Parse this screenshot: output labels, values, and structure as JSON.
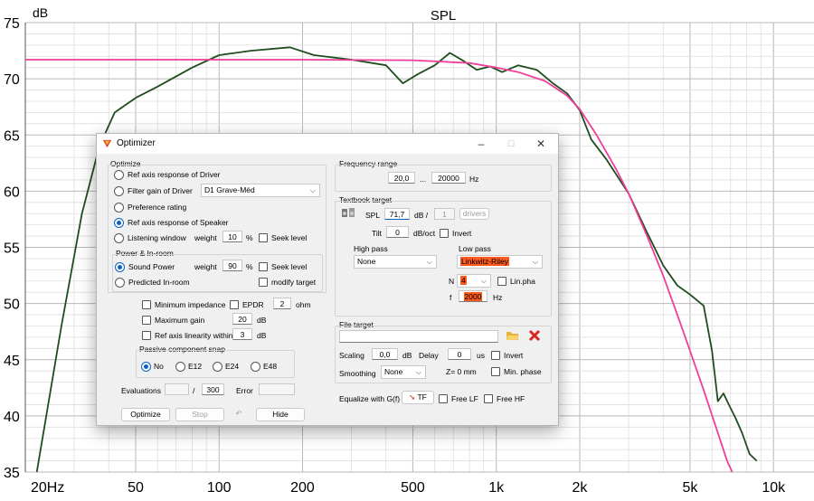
{
  "chart_data": {
    "type": "line",
    "title": "SPL",
    "ylabel": "dB",
    "xscale": "log",
    "xlim": [
      20,
      14000
    ],
    "ylim": [
      35,
      75
    ],
    "x_tick_labels": [
      "20Hz",
      "50",
      "100",
      "200",
      "500",
      "1k",
      "2k",
      "5k",
      "10k"
    ],
    "x_tick_values": [
      20,
      50,
      100,
      200,
      500,
      1000,
      2000,
      5000,
      10000
    ],
    "y_tick_labels": [
      "35",
      "40",
      "45",
      "50",
      "55",
      "60",
      "65",
      "70",
      "75"
    ],
    "y_tick_values": [
      35,
      40,
      45,
      50,
      55,
      60,
      65,
      70,
      75
    ],
    "grid": true,
    "series": [
      {
        "color": "#1e4d1e",
        "points": [
          [
            22,
            35
          ],
          [
            27,
            48
          ],
          [
            32,
            58
          ],
          [
            37,
            64
          ],
          [
            42,
            67
          ],
          [
            50,
            68.3
          ],
          [
            60,
            69.3
          ],
          [
            80,
            71
          ],
          [
            100,
            72.1
          ],
          [
            130,
            72.5
          ],
          [
            180,
            72.8
          ],
          [
            220,
            72.1
          ],
          [
            300,
            71.7
          ],
          [
            400,
            71.2
          ],
          [
            460,
            69.6
          ],
          [
            520,
            70.4
          ],
          [
            600,
            71.2
          ],
          [
            680,
            72.3
          ],
          [
            760,
            71.6
          ],
          [
            850,
            70.8
          ],
          [
            950,
            71.1
          ],
          [
            1050,
            70.6
          ],
          [
            1200,
            71.2
          ],
          [
            1400,
            70.8
          ],
          [
            1600,
            69.6
          ],
          [
            1800,
            68.7
          ],
          [
            2000,
            67.2
          ],
          [
            2200,
            64.6
          ],
          [
            2500,
            62.8
          ],
          [
            3000,
            59.8
          ],
          [
            3500,
            56.3
          ],
          [
            4000,
            53.4
          ],
          [
            4500,
            51.6
          ],
          [
            5000,
            50.8
          ],
          [
            5600,
            49.8
          ],
          [
            6000,
            45.8
          ],
          [
            6300,
            41.3
          ],
          [
            6600,
            42
          ],
          [
            6900,
            41
          ],
          [
            7300,
            39.8
          ],
          [
            7700,
            38.5
          ],
          [
            8200,
            36.6
          ],
          [
            8700,
            36
          ]
        ]
      },
      {
        "color": "#ef3f9a",
        "points": [
          [
            20,
            71.7
          ],
          [
            200,
            71.7
          ],
          [
            500,
            71.65
          ],
          [
            800,
            71.4
          ],
          [
            1000,
            71.0
          ],
          [
            1200,
            70.6
          ],
          [
            1500,
            69.8
          ],
          [
            1800,
            68.5
          ],
          [
            2000,
            67.3
          ],
          [
            2300,
            65
          ],
          [
            2700,
            62
          ],
          [
            3000,
            59.8
          ],
          [
            3500,
            56
          ],
          [
            4000,
            52.5
          ],
          [
            4500,
            49
          ],
          [
            5000,
            45.8
          ],
          [
            5600,
            42.3
          ],
          [
            6200,
            39
          ],
          [
            6800,
            36
          ],
          [
            7100,
            35
          ]
        ]
      }
    ]
  },
  "dialog": {
    "title": "Optimizer",
    "optimize_group": "Optimize",
    "opt_ref_driver": "Ref axis response of Driver",
    "opt_filter_gain": "Filter gain of Driver",
    "driver_select": "D1 Grave-Méd",
    "opt_preference": "Preference rating",
    "opt_ref_speaker": "Ref axis response of Speaker",
    "opt_listening": "Listening window",
    "weight_label": "weight",
    "listening_weight": "10",
    "percent": "%",
    "seek_level": "Seek level",
    "power_group": "Power & In-room",
    "sound_power": "Sound Power",
    "sound_power_weight": "90",
    "predicted": "Predicted In-room",
    "modify_target": "modify target",
    "min_impedance": "Minimum impedance",
    "epdr": "EPDR",
    "epdr_value": "2",
    "ohm": "ohm",
    "max_gain": "Maximum gain",
    "max_gain_value": "20",
    "db": "dB",
    "linearity": "Ref axis linearity within",
    "linearity_value": "3",
    "snap_group": "Passive component snap",
    "snap_no": "No",
    "snap_e12": "E12",
    "snap_e24": "E24",
    "snap_e48": "E48",
    "evaluations": "Evaluations",
    "eval_total": "300",
    "slash": "/",
    "error": "Error",
    "btn_optimize": "Optimize",
    "btn_stop": "Stop",
    "btn_undo": "↶",
    "btn_hide": "Hide",
    "freq_group": "Frequency range",
    "freq_low": "20,0",
    "freq_sep": "...",
    "freq_high": "20000",
    "hz": "Hz",
    "textbook_group": "Textbook target",
    "spl_label": "SPL",
    "spl_value": "71,7",
    "db_per": "dB /",
    "drivers_count": "1",
    "drivers": "drivers",
    "tilt": "Tilt",
    "tilt_value": "0",
    "db_oct": "dB/oct",
    "invert": "Invert",
    "high_pass": "High pass",
    "high_pass_value": "None",
    "low_pass": "Low pass",
    "low_pass_value": "Linkwitz-Riley",
    "n_label": "N",
    "n_value": "4",
    "lin_pha": "Lin.pha",
    "f_label": "f",
    "f_value": "2000",
    "file_group": "File target",
    "scaling": "Scaling",
    "scaling_value": "0,0",
    "delay": "Delay",
    "delay_value": "0",
    "us": "us",
    "z_label": "Z= 0 mm",
    "smoothing": "Smoothing",
    "smoothing_value": "None",
    "min_phase": "Min. phase",
    "equalize": "Equalize with G(f)",
    "tf_button": "TF",
    "free_lf": "Free LF",
    "free_hf": "Free HF"
  }
}
